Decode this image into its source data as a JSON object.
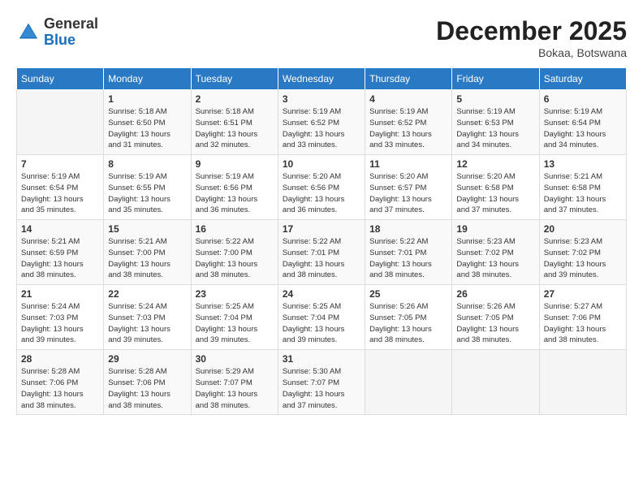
{
  "header": {
    "logo": {
      "general": "General",
      "blue": "Blue"
    },
    "month": "December 2025",
    "location": "Bokaa, Botswana"
  },
  "days_of_week": [
    "Sunday",
    "Monday",
    "Tuesday",
    "Wednesday",
    "Thursday",
    "Friday",
    "Saturday"
  ],
  "weeks": [
    [
      {
        "day": "",
        "info": ""
      },
      {
        "day": "1",
        "info": "Sunrise: 5:18 AM\nSunset: 6:50 PM\nDaylight: 13 hours\nand 31 minutes."
      },
      {
        "day": "2",
        "info": "Sunrise: 5:18 AM\nSunset: 6:51 PM\nDaylight: 13 hours\nand 32 minutes."
      },
      {
        "day": "3",
        "info": "Sunrise: 5:19 AM\nSunset: 6:52 PM\nDaylight: 13 hours\nand 33 minutes."
      },
      {
        "day": "4",
        "info": "Sunrise: 5:19 AM\nSunset: 6:52 PM\nDaylight: 13 hours\nand 33 minutes."
      },
      {
        "day": "5",
        "info": "Sunrise: 5:19 AM\nSunset: 6:53 PM\nDaylight: 13 hours\nand 34 minutes."
      },
      {
        "day": "6",
        "info": "Sunrise: 5:19 AM\nSunset: 6:54 PM\nDaylight: 13 hours\nand 34 minutes."
      }
    ],
    [
      {
        "day": "7",
        "info": "Sunrise: 5:19 AM\nSunset: 6:54 PM\nDaylight: 13 hours\nand 35 minutes."
      },
      {
        "day": "8",
        "info": "Sunrise: 5:19 AM\nSunset: 6:55 PM\nDaylight: 13 hours\nand 35 minutes."
      },
      {
        "day": "9",
        "info": "Sunrise: 5:19 AM\nSunset: 6:56 PM\nDaylight: 13 hours\nand 36 minutes."
      },
      {
        "day": "10",
        "info": "Sunrise: 5:20 AM\nSunset: 6:56 PM\nDaylight: 13 hours\nand 36 minutes."
      },
      {
        "day": "11",
        "info": "Sunrise: 5:20 AM\nSunset: 6:57 PM\nDaylight: 13 hours\nand 37 minutes."
      },
      {
        "day": "12",
        "info": "Sunrise: 5:20 AM\nSunset: 6:58 PM\nDaylight: 13 hours\nand 37 minutes."
      },
      {
        "day": "13",
        "info": "Sunrise: 5:21 AM\nSunset: 6:58 PM\nDaylight: 13 hours\nand 37 minutes."
      }
    ],
    [
      {
        "day": "14",
        "info": "Sunrise: 5:21 AM\nSunset: 6:59 PM\nDaylight: 13 hours\nand 38 minutes."
      },
      {
        "day": "15",
        "info": "Sunrise: 5:21 AM\nSunset: 7:00 PM\nDaylight: 13 hours\nand 38 minutes."
      },
      {
        "day": "16",
        "info": "Sunrise: 5:22 AM\nSunset: 7:00 PM\nDaylight: 13 hours\nand 38 minutes."
      },
      {
        "day": "17",
        "info": "Sunrise: 5:22 AM\nSunset: 7:01 PM\nDaylight: 13 hours\nand 38 minutes."
      },
      {
        "day": "18",
        "info": "Sunrise: 5:22 AM\nSunset: 7:01 PM\nDaylight: 13 hours\nand 38 minutes."
      },
      {
        "day": "19",
        "info": "Sunrise: 5:23 AM\nSunset: 7:02 PM\nDaylight: 13 hours\nand 38 minutes."
      },
      {
        "day": "20",
        "info": "Sunrise: 5:23 AM\nSunset: 7:02 PM\nDaylight: 13 hours\nand 39 minutes."
      }
    ],
    [
      {
        "day": "21",
        "info": "Sunrise: 5:24 AM\nSunset: 7:03 PM\nDaylight: 13 hours\nand 39 minutes."
      },
      {
        "day": "22",
        "info": "Sunrise: 5:24 AM\nSunset: 7:03 PM\nDaylight: 13 hours\nand 39 minutes."
      },
      {
        "day": "23",
        "info": "Sunrise: 5:25 AM\nSunset: 7:04 PM\nDaylight: 13 hours\nand 39 minutes."
      },
      {
        "day": "24",
        "info": "Sunrise: 5:25 AM\nSunset: 7:04 PM\nDaylight: 13 hours\nand 39 minutes."
      },
      {
        "day": "25",
        "info": "Sunrise: 5:26 AM\nSunset: 7:05 PM\nDaylight: 13 hours\nand 38 minutes."
      },
      {
        "day": "26",
        "info": "Sunrise: 5:26 AM\nSunset: 7:05 PM\nDaylight: 13 hours\nand 38 minutes."
      },
      {
        "day": "27",
        "info": "Sunrise: 5:27 AM\nSunset: 7:06 PM\nDaylight: 13 hours\nand 38 minutes."
      }
    ],
    [
      {
        "day": "28",
        "info": "Sunrise: 5:28 AM\nSunset: 7:06 PM\nDaylight: 13 hours\nand 38 minutes."
      },
      {
        "day": "29",
        "info": "Sunrise: 5:28 AM\nSunset: 7:06 PM\nDaylight: 13 hours\nand 38 minutes."
      },
      {
        "day": "30",
        "info": "Sunrise: 5:29 AM\nSunset: 7:07 PM\nDaylight: 13 hours\nand 38 minutes."
      },
      {
        "day": "31",
        "info": "Sunrise: 5:30 AM\nSunset: 7:07 PM\nDaylight: 13 hours\nand 37 minutes."
      },
      {
        "day": "",
        "info": ""
      },
      {
        "day": "",
        "info": ""
      },
      {
        "day": "",
        "info": ""
      }
    ]
  ]
}
